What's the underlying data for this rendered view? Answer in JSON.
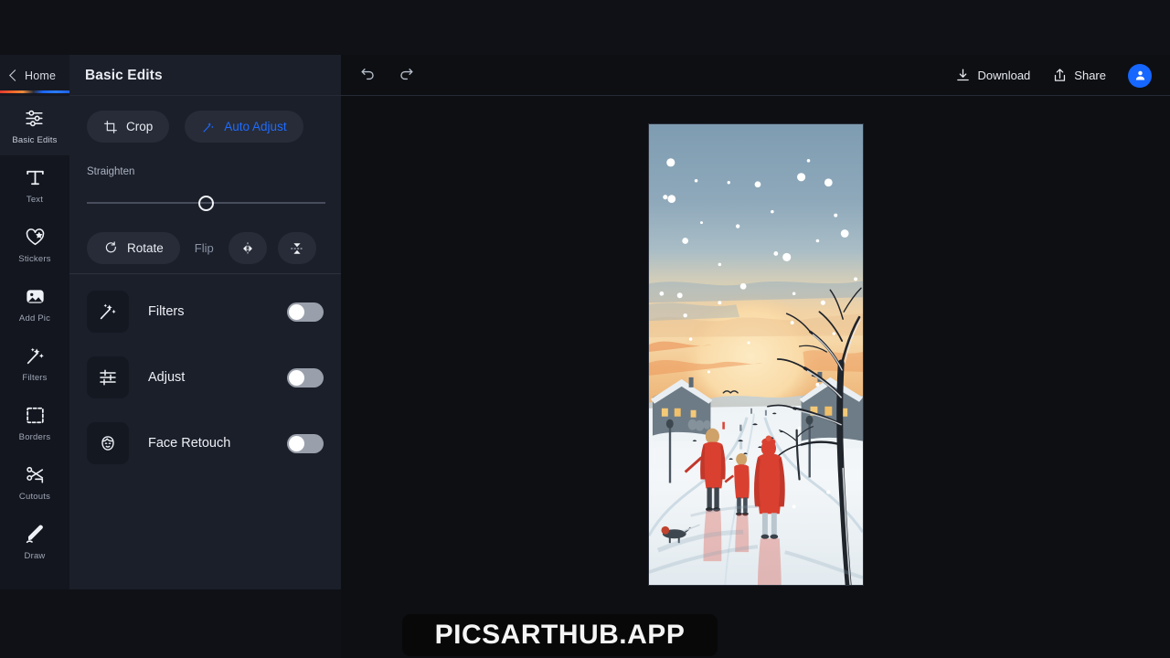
{
  "app": {
    "home_label": "Home",
    "panel_title": "Basic Edits",
    "accent_blue": "#1f6bff",
    "accent_gradient_start": "#e23b2e",
    "accent_gradient_end": "#1f5fe0"
  },
  "toolbar": {
    "undo_icon": "undo-icon",
    "redo_icon": "redo-icon",
    "download_label": "Download",
    "share_label": "Share",
    "avatar_icon": "user-avatar-icon"
  },
  "sidebar": {
    "items": [
      {
        "label": "Basic Edits",
        "icon": "sliders-icon",
        "active": true
      },
      {
        "label": "Text",
        "icon": "text-icon",
        "active": false
      },
      {
        "label": "Stickers",
        "icon": "heart-star-icon",
        "active": false
      },
      {
        "label": "Add Pic",
        "icon": "image-icon",
        "active": false
      },
      {
        "label": "Filters",
        "icon": "magic-wand-icon",
        "active": false
      },
      {
        "label": "Borders",
        "icon": "border-frame-icon",
        "active": false
      },
      {
        "label": "Cutouts",
        "icon": "scissors-icon",
        "active": false
      },
      {
        "label": "Draw",
        "icon": "pencil-icon",
        "active": false
      }
    ]
  },
  "panel": {
    "crop_label": "Crop",
    "auto_adjust_label": "Auto Adjust",
    "straighten_label": "Straighten",
    "straighten_value": 0,
    "rotate_label": "Rotate",
    "flip_label": "Flip",
    "flip_horizontal_icon": "flip-horizontal-icon",
    "flip_vertical_icon": "flip-vertical-icon",
    "toggles": [
      {
        "label": "Filters",
        "icon": "magic-wand-icon",
        "on": false
      },
      {
        "label": "Adjust",
        "icon": "sliders-icon",
        "on": false
      },
      {
        "label": "Face Retouch",
        "icon": "face-icon",
        "on": false
      }
    ]
  },
  "canvas": {
    "image_alt": "winter-village-snow-scene-three-people-red-coats-with-dog"
  },
  "watermark": {
    "text": "PICSARTHUB.APP"
  }
}
